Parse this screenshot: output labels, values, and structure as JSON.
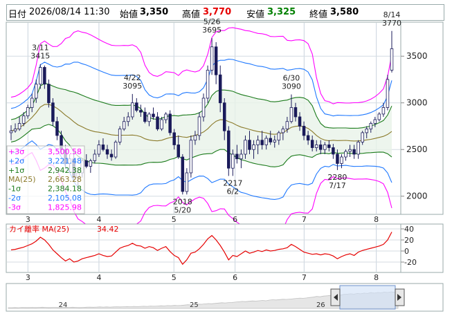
{
  "header": {
    "date_label": "日付",
    "datetime": "2026/08/14 11:30",
    "open_label": "始値",
    "open": "3,350",
    "high_label": "高値",
    "high": "3,770",
    "low_label": "安値",
    "low": "3,325",
    "close_label": "終値",
    "close": "3,580",
    "colors": {
      "high": "#e60000",
      "low": "#008000",
      "text": "#000000"
    }
  },
  "chart_data": [
    {
      "type": "candlestick",
      "panel": "price",
      "ylim": [
        1820,
        3850
      ],
      "y_ticks": [
        2000,
        2500,
        3000,
        3500
      ],
      "x_tick_labels": [
        "3",
        "4",
        "5",
        "6",
        "7",
        "8"
      ],
      "candles": [
        [
          2680,
          2760,
          2600,
          2700
        ],
        [
          2700,
          2780,
          2680,
          2720
        ],
        [
          2720,
          2850,
          2700,
          2780
        ],
        [
          2780,
          2900,
          2750,
          2860
        ],
        [
          2860,
          2980,
          2830,
          2950
        ],
        [
          2950,
          3100,
          2900,
          3050
        ],
        [
          3050,
          3250,
          3000,
          3200
        ],
        [
          3200,
          3415,
          3150,
          3380
        ],
        [
          3380,
          3400,
          3150,
          3200
        ],
        [
          3200,
          3250,
          2950,
          3000
        ],
        [
          3000,
          3050,
          2750,
          2800
        ],
        [
          2800,
          2850,
          2600,
          2650
        ],
        [
          2650,
          2700,
          2450,
          2500
        ],
        [
          2500,
          2550,
          2300,
          2350
        ],
        [
          2350,
          2450,
          2250,
          2400
        ],
        [
          2400,
          2480,
          2150,
          2200
        ],
        [
          2200,
          2300,
          2100,
          2250
        ],
        [
          2250,
          2400,
          2200,
          2380
        ],
        [
          2380,
          2450,
          2300,
          2320
        ],
        [
          2320,
          2400,
          2250,
          2380
        ],
        [
          2380,
          2500,
          2350,
          2450
        ],
        [
          2450,
          2600,
          2420,
          2550
        ],
        [
          2550,
          2620,
          2480,
          2500
        ],
        [
          2500,
          2550,
          2400,
          2450
        ],
        [
          2450,
          2500,
          2380,
          2420
        ],
        [
          2420,
          2600,
          2400,
          2580
        ],
        [
          2580,
          2750,
          2550,
          2720
        ],
        [
          2720,
          2850,
          2700,
          2800
        ],
        [
          2800,
          2900,
          2750,
          2850
        ],
        [
          2850,
          3095,
          2820,
          3000
        ],
        [
          3000,
          3050,
          2900,
          2920
        ],
        [
          2920,
          2980,
          2850,
          2900
        ],
        [
          2900,
          2950,
          2780,
          2800
        ],
        [
          2800,
          2900,
          2750,
          2880
        ],
        [
          2880,
          2950,
          2820,
          2850
        ],
        [
          2850,
          2900,
          2700,
          2720
        ],
        [
          2720,
          2850,
          2700,
          2820
        ],
        [
          2820,
          2900,
          2780,
          2880
        ],
        [
          2880,
          2920,
          2650,
          2680
        ],
        [
          2680,
          2720,
          2500,
          2550
        ],
        [
          2550,
          2650,
          2400,
          2420
        ],
        [
          2420,
          2450,
          2018,
          2050
        ],
        [
          2050,
          2300,
          2018,
          2250
        ],
        [
          2250,
          2650,
          2200,
          2600
        ],
        [
          2600,
          2700,
          2550,
          2650
        ],
        [
          2650,
          2900,
          2600,
          2850
        ],
        [
          2850,
          3100,
          2800,
          3050
        ],
        [
          3050,
          3400,
          3000,
          3350
        ],
        [
          3350,
          3695,
          3300,
          3600
        ],
        [
          3600,
          3650,
          3200,
          3300
        ],
        [
          3300,
          3400,
          2900,
          3000
        ],
        [
          3000,
          3050,
          2600,
          2700
        ],
        [
          2700,
          2750,
          2217,
          2300
        ],
        [
          2300,
          2500,
          2217,
          2450
        ],
        [
          2450,
          2550,
          2350,
          2400
        ],
        [
          2400,
          2500,
          2300,
          2450
        ],
        [
          2450,
          2650,
          2400,
          2600
        ],
        [
          2600,
          2700,
          2450,
          2500
        ],
        [
          2500,
          2600,
          2400,
          2550
        ],
        [
          2550,
          2650,
          2450,
          2600
        ],
        [
          2600,
          2700,
          2500,
          2550
        ],
        [
          2550,
          2650,
          2500,
          2620
        ],
        [
          2620,
          2700,
          2550,
          2580
        ],
        [
          2580,
          2650,
          2520,
          2600
        ],
        [
          2600,
          2700,
          2550,
          2680
        ],
        [
          2680,
          2750,
          2600,
          2720
        ],
        [
          2720,
          2850,
          2680,
          2800
        ],
        [
          2800,
          3090,
          2780,
          2950
        ],
        [
          2950,
          3000,
          2800,
          2850
        ],
        [
          2850,
          2900,
          2700,
          2750
        ],
        [
          2750,
          2800,
          2600,
          2650
        ],
        [
          2650,
          2700,
          2550,
          2600
        ],
        [
          2600,
          2650,
          2480,
          2520
        ],
        [
          2520,
          2600,
          2480,
          2550
        ],
        [
          2550,
          2600,
          2450,
          2500
        ],
        [
          2500,
          2580,
          2450,
          2550
        ],
        [
          2550,
          2600,
          2480,
          2520
        ],
        [
          2520,
          2560,
          2400,
          2450
        ],
        [
          2450,
          2500,
          2280,
          2350
        ],
        [
          2350,
          2450,
          2300,
          2420
        ],
        [
          2420,
          2500,
          2380,
          2480
        ],
        [
          2480,
          2550,
          2420,
          2500
        ],
        [
          2500,
          2550,
          2400,
          2450
        ],
        [
          2450,
          2600,
          2400,
          2580
        ],
        [
          2580,
          2700,
          2550,
          2680
        ],
        [
          2680,
          2750,
          2620,
          2720
        ],
        [
          2720,
          2800,
          2680,
          2780
        ],
        [
          2780,
          2850,
          2740,
          2820
        ],
        [
          2820,
          2900,
          2800,
          2880
        ],
        [
          2880,
          3000,
          2850,
          2950
        ],
        [
          2950,
          3300,
          2920,
          3250
        ],
        [
          3350,
          3770,
          3325,
          3580
        ]
      ],
      "series": [
        {
          "name": "+3σ",
          "value": "3,500.58",
          "color": "#ff00ff"
        },
        {
          "name": "+2σ",
          "value": "3,221.48",
          "color": "#1e78ff"
        },
        {
          "name": "+1σ",
          "value": "2,942.38",
          "color": "#1a7a1a"
        },
        {
          "name": "MA(25)",
          "value": "2,663.28",
          "color": "#8b7a2a"
        },
        {
          "name": "-1σ",
          "value": "2,384.18",
          "color": "#1a7a1a"
        },
        {
          "name": "-2σ",
          "value": "2,105.08",
          "color": "#1e78ff"
        },
        {
          "name": "-3σ",
          "value": "1,825.98",
          "color": "#ff00ff"
        }
      ],
      "annotations": [
        {
          "date": "3/11",
          "value": "3415",
          "idx": 7,
          "pos": "above"
        },
        {
          "date": "4/22",
          "value": "3095",
          "idx": 29,
          "pos": "above"
        },
        {
          "date": "5/26",
          "value": "3695",
          "idx": 48,
          "pos": "above"
        },
        {
          "date": "5/20",
          "value": "2018",
          "idx": 41,
          "pos": "below"
        },
        {
          "date": "6/2",
          "value": "2217",
          "idx": 53,
          "pos": "below"
        },
        {
          "date": "6/30",
          "value": "3090",
          "idx": 67,
          "pos": "above"
        },
        {
          "date": "7/17",
          "value": "2280",
          "idx": 78,
          "pos": "below"
        },
        {
          "date": "8/14",
          "value": "3770",
          "idx": 91,
          "pos": "above"
        }
      ]
    },
    {
      "type": "line",
      "panel": "deviation",
      "title": "カイ離率 MA(25)",
      "value": "34.42",
      "ylim": [
        -35,
        45
      ],
      "y_ticks": [
        40,
        20,
        0,
        -20
      ],
      "x_tick_labels": [
        "3",
        "4",
        "5",
        "6",
        "7",
        "8"
      ],
      "values": [
        2,
        3,
        5,
        7,
        10,
        13,
        18,
        25,
        20,
        12,
        2,
        -5,
        -12,
        -18,
        -14,
        -20,
        -18,
        -14,
        -12,
        -10,
        -8,
        -5,
        -8,
        -10,
        -9,
        -2,
        5,
        8,
        10,
        14,
        10,
        9,
        5,
        8,
        6,
        1,
        5,
        8,
        -1,
        -8,
        -12,
        -24,
        -16,
        -4,
        -2,
        4,
        12,
        22,
        28,
        20,
        10,
        -2,
        -16,
        -8,
        -10,
        -5,
        0,
        -4,
        -2,
        1,
        -1,
        2,
        0,
        1,
        3,
        4,
        6,
        12,
        8,
        3,
        -2,
        -4,
        -6,
        -5,
        -7,
        -5,
        -6,
        -9,
        -14,
        -10,
        -7,
        -5,
        -8,
        -2,
        1,
        3,
        5,
        7,
        9,
        12,
        20,
        34.42
      ],
      "line_color": "#e60000"
    },
    {
      "type": "area",
      "panel": "navigator",
      "x_tick_labels": [
        "24",
        "25",
        "26"
      ],
      "values": [
        4,
        4,
        5,
        4,
        6,
        5,
        5,
        6,
        5,
        6,
        7,
        6,
        5,
        6,
        6,
        5,
        6,
        7,
        6,
        7,
        6,
        5,
        6,
        7,
        8,
        7,
        8,
        9,
        8,
        9,
        8,
        9,
        10,
        9,
        10,
        11,
        10,
        12,
        11,
        12,
        13,
        12,
        14,
        13,
        14,
        16,
        15,
        17,
        16,
        18,
        17,
        18,
        20,
        22,
        21,
        24,
        26,
        25,
        27,
        29,
        28,
        30,
        32,
        34,
        33,
        35,
        36,
        38,
        40,
        42,
        41,
        43,
        45,
        44,
        46,
        48,
        46,
        50,
        52,
        51,
        53,
        55,
        54,
        56,
        58,
        60,
        62,
        61,
        63,
        66,
        68,
        72,
        70,
        74,
        76,
        78,
        80,
        82,
        80,
        84,
        86,
        88,
        86,
        90,
        88,
        92,
        90,
        95,
        92,
        96,
        94,
        98,
        96,
        100,
        97,
        99
      ]
    }
  ]
}
